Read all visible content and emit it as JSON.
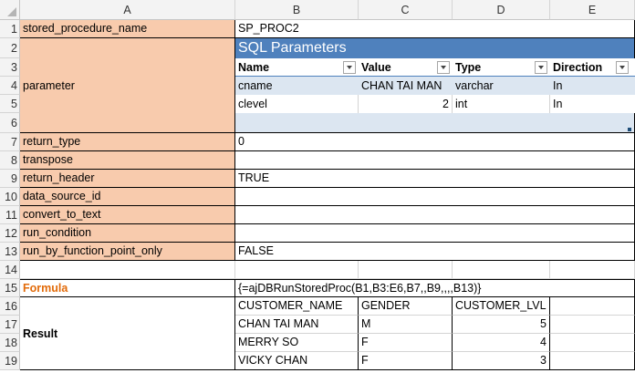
{
  "columns": [
    "A",
    "B",
    "C",
    "D",
    "E"
  ],
  "rows": [
    "1",
    "2",
    "3",
    "4",
    "5",
    "6",
    "7",
    "8",
    "9",
    "10",
    "11",
    "12",
    "13",
    "14",
    "15",
    "16",
    "17",
    "18",
    "19"
  ],
  "labels": {
    "stored_procedure_name": "stored_procedure_name",
    "parameter": "parameter",
    "return_type": "return_type",
    "transpose": "transpose",
    "return_header": "return_header",
    "data_source_id": "data_source_id",
    "convert_to_text": "convert_to_text",
    "run_condition": "run_condition",
    "run_by_function_point_only": "run_by_function_point_only",
    "formula": "Formula",
    "result": "Result"
  },
  "values": {
    "stored_procedure_name": "SP_PROC2",
    "return_type": "0",
    "return_header": "TRUE",
    "run_by_function_point_only": "FALSE",
    "formula": "{=ajDBRunStoredProc(B1,B3:E6,B7,,B9,,,,B13)}"
  },
  "sql_table": {
    "title": "SQL Parameters",
    "headers": [
      "Name",
      "Value",
      "Type",
      "Direction"
    ],
    "rows": [
      [
        "cname",
        "CHAN TAI MAN",
        "varchar",
        "In"
      ],
      [
        "clevel",
        "2",
        "int",
        "In"
      ]
    ]
  },
  "result_table": {
    "headers": [
      "CUSTOMER_NAME",
      "GENDER",
      "CUSTOMER_LVL"
    ],
    "rows": [
      [
        "CHAN TAI MAN",
        "M",
        "5"
      ],
      [
        "MERRY SO",
        "F",
        "4"
      ],
      [
        "VICKY CHAN",
        "F",
        "3"
      ]
    ]
  },
  "colors": {
    "label_fill": "#f8cbad",
    "table_header": "#4f81bd",
    "table_band": "#dce6f1",
    "formula_label": "#e26b0a"
  }
}
